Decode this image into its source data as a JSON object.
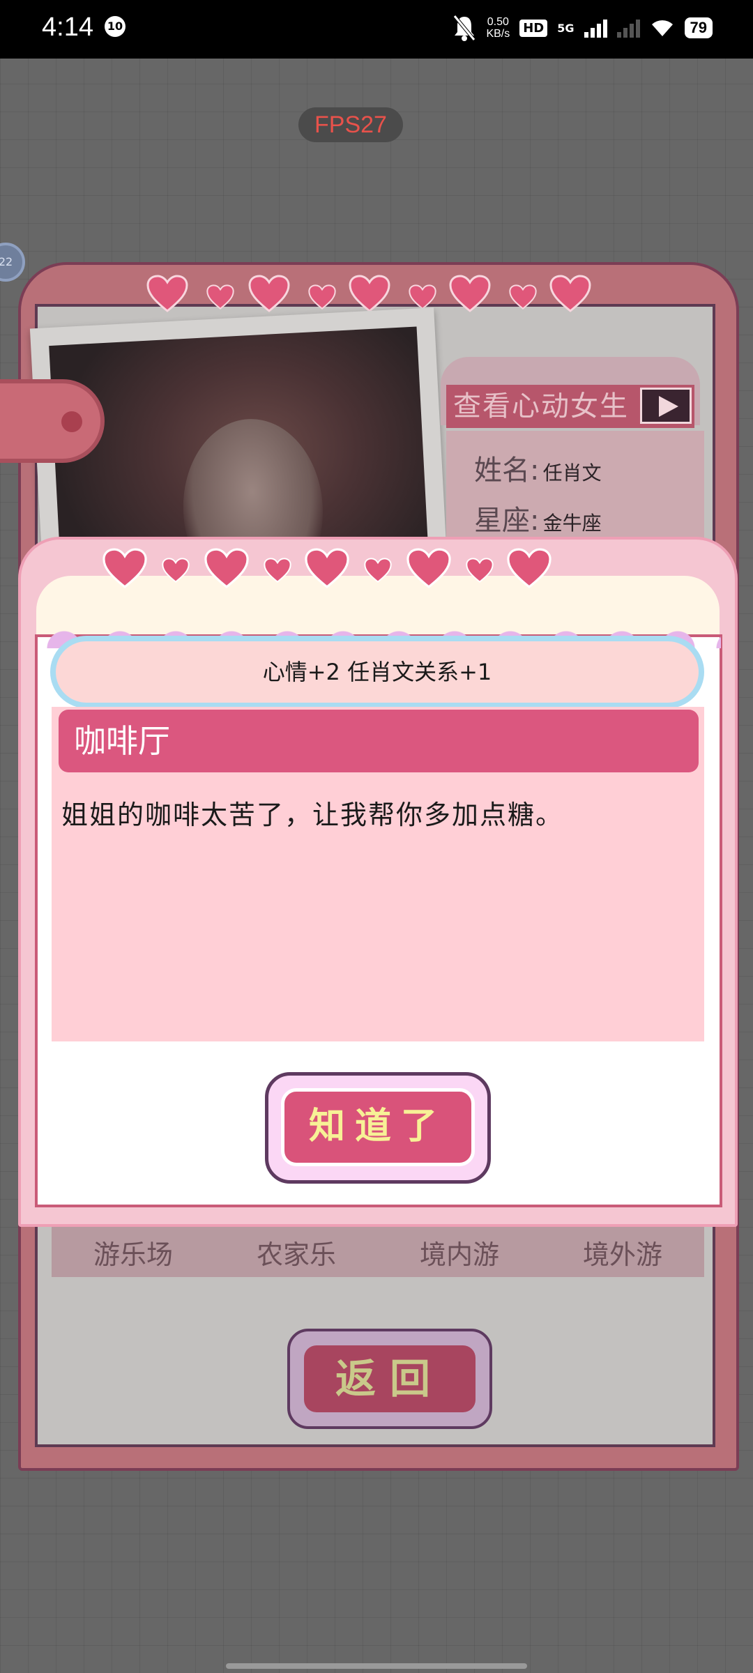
{
  "status_bar": {
    "time": "4:14",
    "notif_badge": "10",
    "net_speed_value": "0.50",
    "net_speed_unit": "KB/s",
    "hd": "HD",
    "network": "5G",
    "battery": "79"
  },
  "fps_label": "FPS27",
  "side_circle_text": "22",
  "profile": {
    "header_label": "查看心动女生",
    "name_key": "姓名",
    "name_value": "任肖文",
    "constellation_key": "星座",
    "constellation_value": "金牛座"
  },
  "back_tabs": [
    "游乐场",
    "农家乐",
    "境内游",
    "境外游"
  ],
  "back_button_label": "返回",
  "popup": {
    "reward_text": "心情+2 任肖文关系+1",
    "title": "咖啡厅",
    "message": "姐姐的咖啡太苦了，让我帮你多加点糖。",
    "ok_label": "知道了"
  },
  "colors": {
    "heart": "#e0577a",
    "accent_pink": "#db577f",
    "button_text": "#f7f196"
  }
}
